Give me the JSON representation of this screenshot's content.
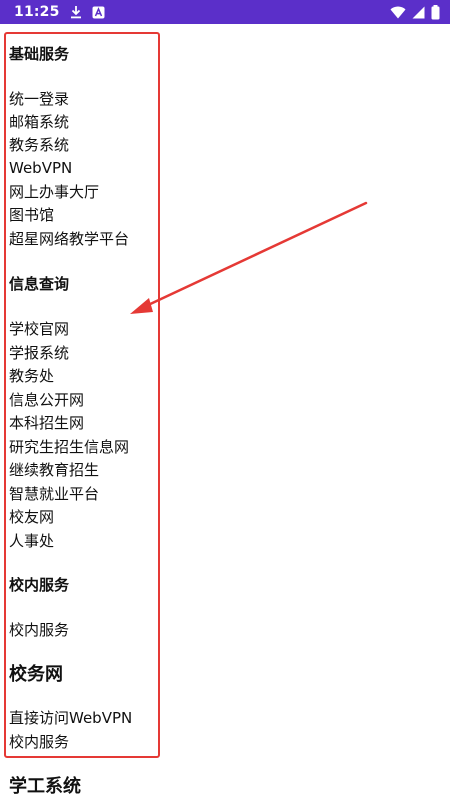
{
  "status_bar": {
    "time": "11:25",
    "left_icons": [
      "download-icon",
      "a-notification-icon"
    ],
    "right_icons": [
      "wifi-icon",
      "cell-signal-icon",
      "battery-icon"
    ],
    "background_color": "#5b2fc9"
  },
  "sections": [
    {
      "title": "基础服务",
      "links": [
        "统一登录",
        "邮箱系统",
        "教务系统",
        "WebVPN",
        "网上办事大厅",
        "图书馆",
        "超星网络教学平台"
      ]
    },
    {
      "title": "信息查询",
      "links": [
        "学校官网",
        "学报系统",
        "教务处",
        "信息公开网",
        "本科招生网",
        "研究生招生信息网",
        "继续教育招生",
        "智慧就业平台",
        "校友网",
        "人事处"
      ]
    },
    {
      "title": "校内服务",
      "links": [
        "校内服务"
      ]
    },
    {
      "title": "校务网",
      "links": [
        "直接访问WebVPN",
        "校内服务"
      ]
    },
    {
      "title": "学工系统",
      "links": []
    }
  ],
  "annotation": {
    "color": "#e53935"
  }
}
